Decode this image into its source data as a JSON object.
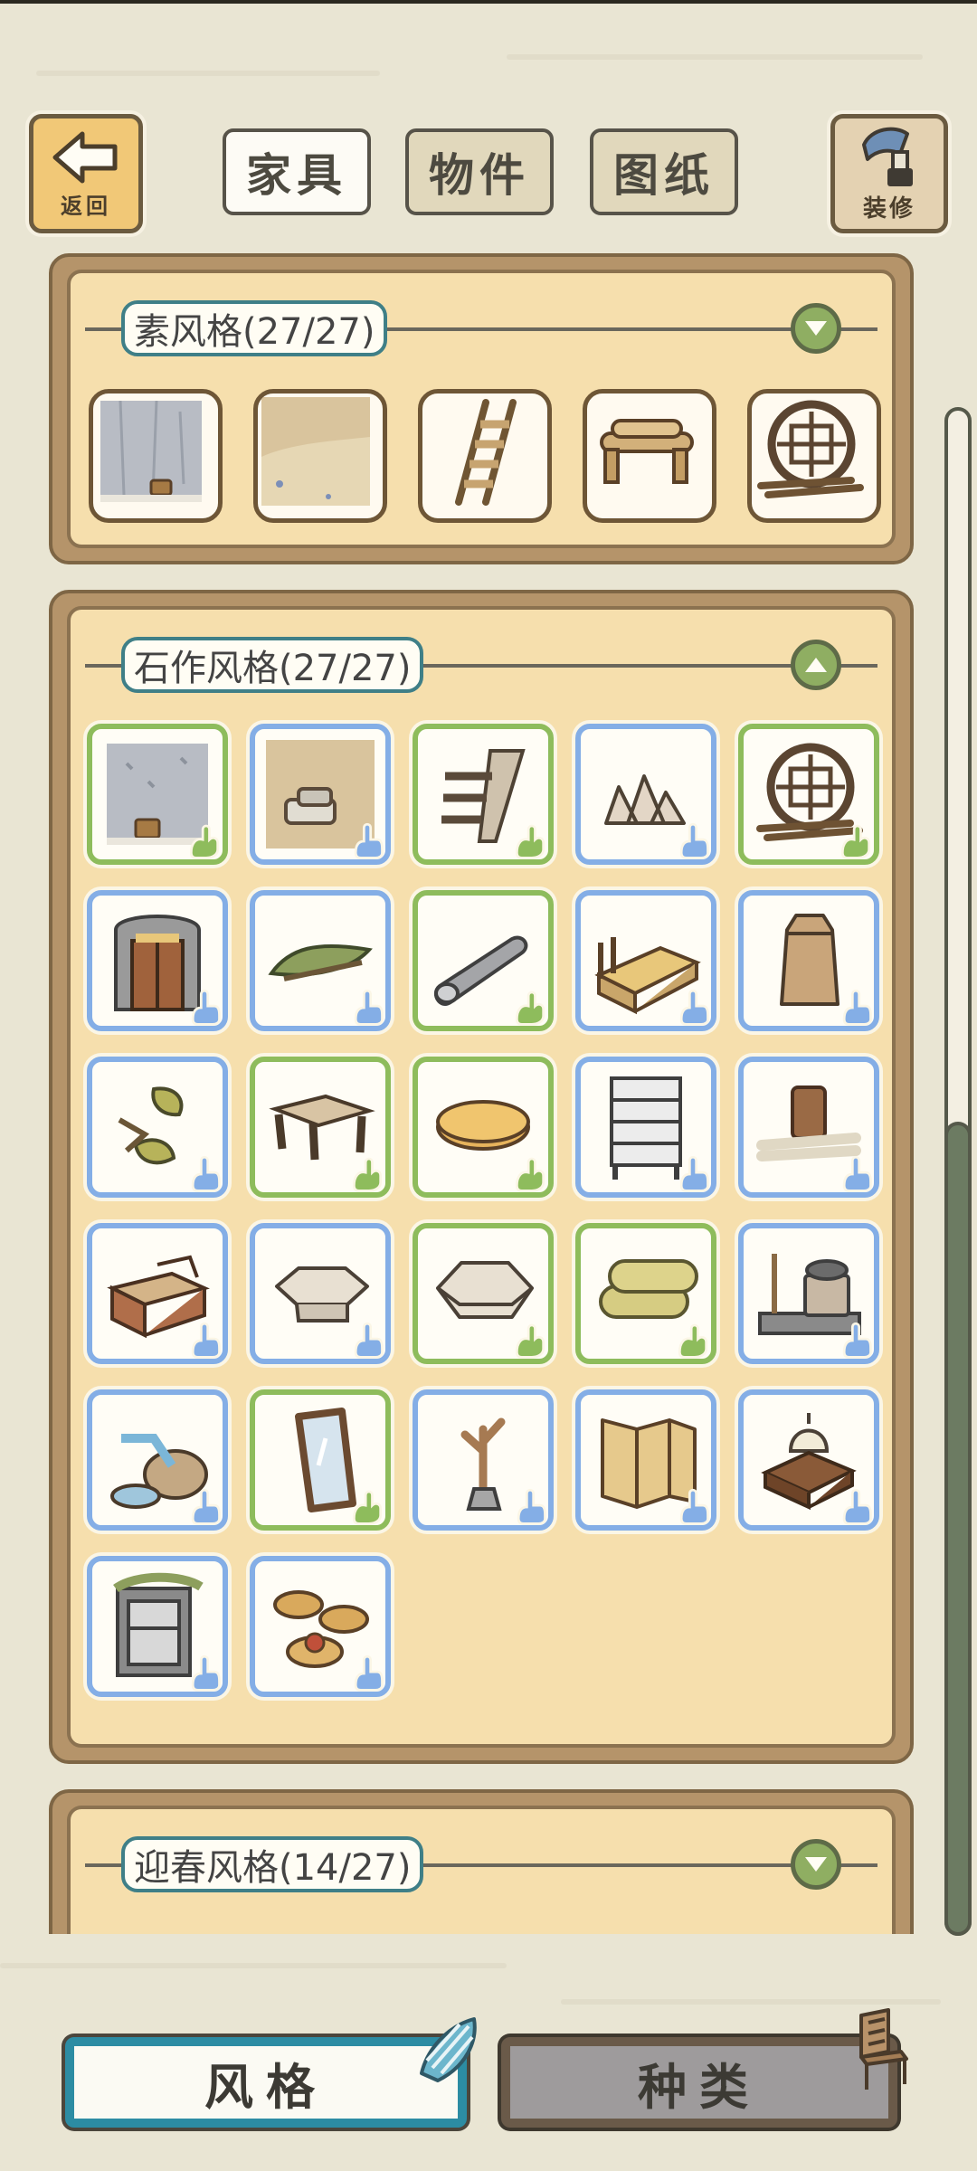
{
  "header": {
    "back_label": "返回",
    "tabs": [
      {
        "label": "家具",
        "active": true
      },
      {
        "label": "物件",
        "active": false
      },
      {
        "label": "图纸",
        "active": false
      }
    ],
    "decorate_label": "装修"
  },
  "sections": [
    {
      "title": "素风格(27/27)",
      "expanded": false,
      "toggle_icon": "chevron-down-icon"
    },
    {
      "title": "石作风格(27/27)",
      "expanded": true,
      "toggle_icon": "chevron-up-icon"
    },
    {
      "title": "迎春风格(14/27)",
      "expanded": false,
      "toggle_icon": "chevron-down-icon"
    }
  ],
  "preview_items": [
    "wall-icon",
    "floor-icon",
    "ladder-icon",
    "log-bench-icon",
    "round-window-icon"
  ],
  "stone_items": [
    {
      "icon": "stone-wall-icon",
      "badge": "green"
    },
    {
      "icon": "stone-floor-icon",
      "badge": "blue"
    },
    {
      "icon": "stone-stairs-icon",
      "badge": "green"
    },
    {
      "icon": "rock-pile-icon",
      "badge": "blue"
    },
    {
      "icon": "round-window-icon",
      "badge": "green"
    },
    {
      "icon": "stone-door-icon",
      "badge": "blue"
    },
    {
      "icon": "leaf-bed-icon",
      "badge": "blue"
    },
    {
      "icon": "stone-roller-icon",
      "badge": "green"
    },
    {
      "icon": "bed-icon",
      "badge": "blue"
    },
    {
      "icon": "jar-icon",
      "badge": "blue"
    },
    {
      "icon": "leaf-decor-icon",
      "badge": "blue"
    },
    {
      "icon": "stone-table-icon",
      "badge": "green"
    },
    {
      "icon": "round-mat-icon",
      "badge": "green"
    },
    {
      "icon": "stone-shelf-icon",
      "badge": "blue"
    },
    {
      "icon": "log-stump-icon",
      "badge": "blue"
    },
    {
      "icon": "wood-box-icon",
      "badge": "blue"
    },
    {
      "icon": "stone-stool-icon",
      "badge": "blue"
    },
    {
      "icon": "stone-block-icon",
      "badge": "green"
    },
    {
      "icon": "hay-roll-icon",
      "badge": "green"
    },
    {
      "icon": "stone-stove-icon",
      "badge": "blue"
    },
    {
      "icon": "water-basin-icon",
      "badge": "blue"
    },
    {
      "icon": "mirror-icon",
      "badge": "green"
    },
    {
      "icon": "coat-tree-icon",
      "badge": "blue"
    },
    {
      "icon": "folding-screen-icon",
      "badge": "blue"
    },
    {
      "icon": "stone-lamp-icon",
      "badge": "blue"
    },
    {
      "icon": "stone-cabinet-icon",
      "badge": "blue"
    },
    {
      "icon": "baskets-icon",
      "badge": "blue"
    }
  ],
  "bottom_buttons": [
    {
      "label": "风格",
      "active": true,
      "icon": "shell-icon"
    },
    {
      "label": "种类",
      "active": false,
      "icon": "chair-icon"
    }
  ],
  "colors": {
    "green_badge": "#8ebc5c",
    "blue_badge": "#84aee6",
    "panel_bg": "#f6dfad",
    "accent_teal": "#2c8ca3"
  }
}
